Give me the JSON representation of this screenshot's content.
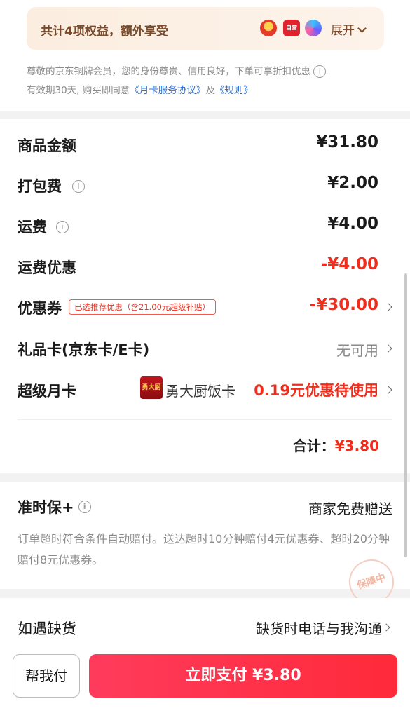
{
  "benefits": {
    "title": "共计4项权益，额外享受",
    "icons": [
      "mascot-icon",
      "jd-self-run-icon",
      "app-icon"
    ],
    "icon_text_2": "自营",
    "expand_label": "展开"
  },
  "notice": {
    "line1": "尊敬的京东铜牌会员，您的身份尊贵、信用良好，下单可享折扣优惠",
    "line2_prefix": "有效期30天, 购买即同意",
    "agreement_link": "《月卡服务协议》",
    "and": "及",
    "rules_link": "《规则》"
  },
  "fees": {
    "goods": {
      "label": "商品金额",
      "value": "¥31.80"
    },
    "packing": {
      "label": "打包费",
      "value": "¥2.00"
    },
    "shipping": {
      "label": "运费",
      "value": "¥4.00"
    },
    "shipping_discount": {
      "label": "运费优惠",
      "value": "-¥4.00"
    },
    "coupon": {
      "label": "优惠券",
      "tag": "已选推荐优惠（含21.00元超级补贴）",
      "value": "-¥30.00"
    },
    "gift_card": {
      "label": "礼品卡(京东卡/E卡)",
      "value": "无可用"
    },
    "super_card": {
      "label": "超级月卡",
      "logo_text": "勇大厨",
      "shop": "勇大厨饭卡",
      "value": "0.19元优惠待使用"
    },
    "total_label": "合计：",
    "total_value": "¥3.80"
  },
  "ontime": {
    "title": "准时保+",
    "gift": "商家免费赠送",
    "desc": "订单超时符合条件自动赔付。送达超时10分钟赔付4元优惠券、超时20分钟赔付8元优惠券。",
    "stamp": "保障中"
  },
  "stock": {
    "label": "如遇缺货",
    "value": "缺货时电话与我沟通"
  },
  "footer": {
    "help_pay": "帮我付",
    "pay_now": "立即支付 ¥3.80"
  },
  "colors": {
    "accent_red": "#f02d1c",
    "pay_button": "#ff2a3a",
    "link_blue": "#2a6fd9"
  }
}
